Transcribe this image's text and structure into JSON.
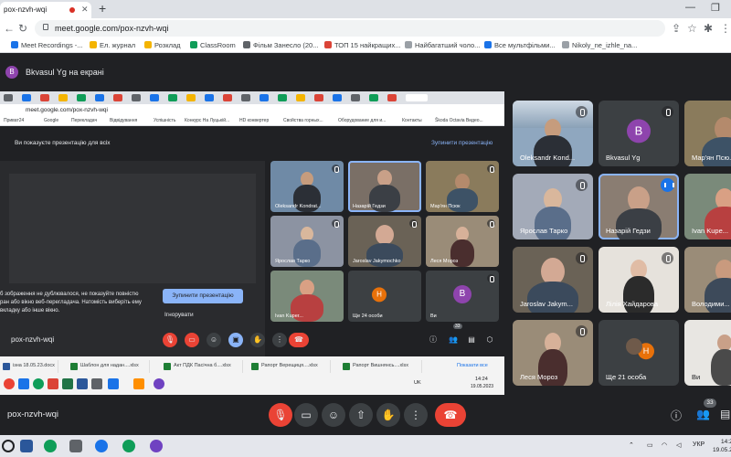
{
  "browser": {
    "tab_title": "pox-nzvh-wqi",
    "url": "meet.google.com/pox-nzvh-wqi",
    "bookmarks": [
      "Meet Recordings -...",
      "Ел. журнал",
      "Розклад",
      "ClassRoom",
      "Фільм Занесло (20...",
      "ТОП 15 найкращих...",
      "Найбагатший чоло...",
      "Все мультфільми...",
      "Nikoly_ne_izhle_na..."
    ]
  },
  "meet": {
    "presenter_label": "Bkvasul Yg на екрані",
    "meeting_code": "pox-nzvh-wqi",
    "participant_count": "33"
  },
  "shared_screen": {
    "inner_url": "meet.google.com/pox-nzvh-wqi",
    "inner_bookmarks": [
      "Приват24",
      "Google",
      "Перекладач",
      "Відвідування",
      "Успішність",
      "Конкурс На Луцькій...",
      "HD конвертер",
      "Свойства горных...",
      "Оборудование для и...",
      "Контакты",
      "Škoda Octavia Видео..."
    ],
    "banner_text": "Ви показуєте презентацію для всіх",
    "banner_stop": "Зупинити презентацію",
    "mirror_text": "б зображення не дублювалося, не показуйте повністю ран або вікно веб-перегладача. Натомість виберіть ему вкладку або інше вікно.",
    "mirror_stop": "Зупинити презентацію",
    "mirror_ignore": "Ігнорувати",
    "meeting_code": "pox-nzvh-wqi",
    "participant_count": "33",
    "tiles": [
      {
        "name": "Oleksandr Kondrat..."
      },
      {
        "name": "Назарій Гедзи"
      },
      {
        "name": "Мар'ян Псюк"
      },
      {
        "name": "Ярослав Тарко"
      },
      {
        "name": "Jaroslav Jakymochko"
      },
      {
        "name": "Леся Мороз"
      },
      {
        "name": "Ivan Kuper..."
      },
      {
        "name": "Ще 24 особи",
        "initial": "H"
      },
      {
        "name": "Ви",
        "initial": "B"
      }
    ],
    "downloads": [
      "ізна 18.05.23.docx",
      "Шаблон для надан....xlsx",
      "Акт ПДК Пасічна б....xlsx",
      "Рапорт Верещиця....xlsx",
      "Рапорт Вишнянсь....xlsx"
    ],
    "show_all": "Показати все",
    "time": "14:24",
    "date": "19.05.2023",
    "lang": "UK"
  },
  "tiles": [
    {
      "name": "Oleksandr Kond..."
    },
    {
      "name": "Bkvasul Yg",
      "initial": "B"
    },
    {
      "name": "Мар'ян Псю..."
    },
    {
      "name": "Ярослав Тарко"
    },
    {
      "name": "Назарій Гедзи"
    },
    {
      "name": "Ivan Kupe..."
    },
    {
      "name": "Jaroslav Jakym..."
    },
    {
      "name": "Лілія Хайдарова"
    },
    {
      "name": "Володими..."
    },
    {
      "name": "Леся Мороз"
    },
    {
      "name": "Ще 21 особа",
      "initial": "H"
    },
    {
      "name": "Ви"
    }
  ],
  "taskbar": {
    "lang": "УКР",
    "time": "14:2",
    "date": "19.05.2"
  }
}
